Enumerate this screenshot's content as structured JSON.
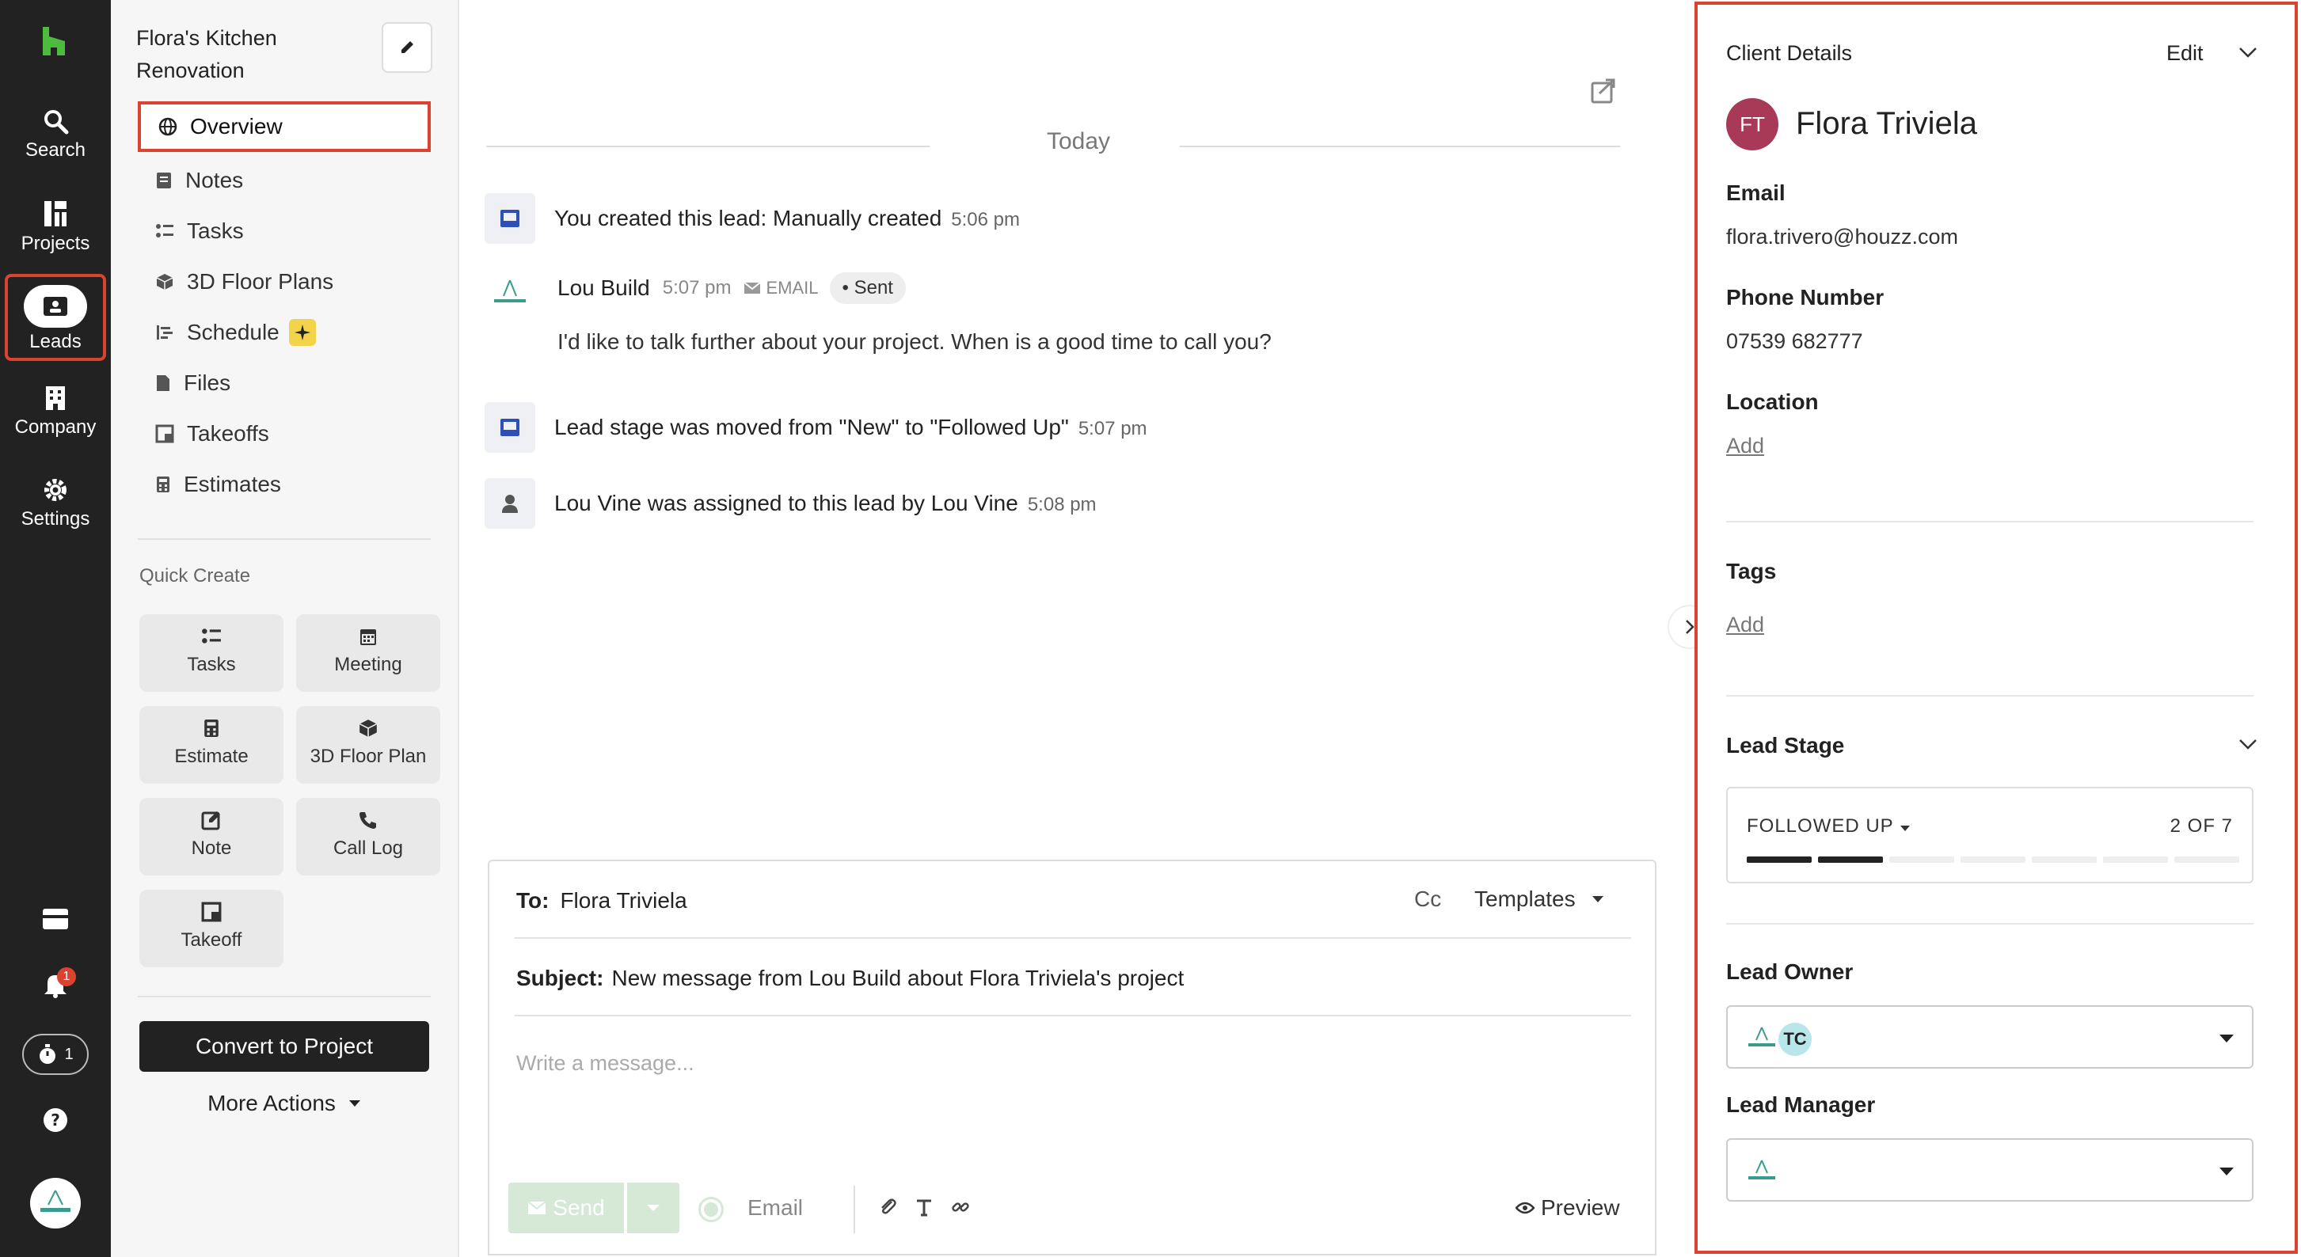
{
  "rail": {
    "items": [
      {
        "label": "Search"
      },
      {
        "label": "Projects"
      },
      {
        "label": "Leads"
      },
      {
        "label": "Company"
      },
      {
        "label": "Settings"
      }
    ],
    "notification_count": "1",
    "timer_count": "1"
  },
  "nav": {
    "project_title": "Flora's Kitchen Renovation",
    "items": [
      {
        "label": "Overview"
      },
      {
        "label": "Notes"
      },
      {
        "label": "Tasks"
      },
      {
        "label": "3D Floor Plans"
      },
      {
        "label": "Schedule"
      },
      {
        "label": "Files"
      },
      {
        "label": "Takeoffs"
      },
      {
        "label": "Estimates"
      }
    ],
    "quick_create_label": "Quick Create",
    "quick_create": [
      {
        "label": "Tasks"
      },
      {
        "label": "Meeting"
      },
      {
        "label": "Estimate"
      },
      {
        "label": "3D Floor Plan"
      },
      {
        "label": "Note"
      },
      {
        "label": "Call Log"
      },
      {
        "label": "Takeoff"
      }
    ],
    "convert_label": "Convert to Project",
    "more_actions_label": "More Actions"
  },
  "main": {
    "date_divider": "Today",
    "activities": [
      {
        "text": "You created this lead: Manually created",
        "time": "5:06 pm"
      },
      {
        "text": "Lead stage was moved from \"New\" to \"Followed Up\"",
        "time": "5:07 pm"
      },
      {
        "text": "Lou Vine was assigned to this lead by Lou Vine",
        "time": "5:08 pm"
      }
    ],
    "message": {
      "sender": "Lou Build",
      "time": "5:07 pm",
      "channel": "EMAIL",
      "status": "Sent",
      "body": "I'd like to talk further about your project. When is a good time to call you?"
    },
    "composer": {
      "to_label": "To:",
      "to_value": "Flora Triviela",
      "cc_label": "Cc",
      "templates_label": "Templates",
      "subject_label": "Subject:",
      "subject_value": "New message from Lou Build about Flora Triviela's project",
      "placeholder": "Write a message...",
      "send_label": "Send",
      "channel_label": "Email",
      "preview_label": "Preview"
    }
  },
  "panel": {
    "title": "Client Details",
    "edit_label": "Edit",
    "initials": "FT",
    "client_name": "Flora Triviela",
    "email_label": "Email",
    "email_value": "flora.trivero@houzz.com",
    "phone_label": "Phone Number",
    "phone_value": "07539 682777",
    "location_label": "Location",
    "location_add": "Add",
    "tags_label": "Tags",
    "tags_add": "Add",
    "lead_stage_label": "Lead Stage",
    "stage_value": "FOLLOWED UP",
    "stage_count": "2 OF 7",
    "stage_progress": 2,
    "stage_total": 7,
    "lead_owner_label": "Lead Owner",
    "owner_initials": "TC",
    "lead_manager_label": "Lead Manager"
  },
  "colors": {
    "rail_bg": "#222222",
    "highlight": "#d9432f",
    "avatar": "#a83a57",
    "brand_green": "#4dbb3e"
  }
}
